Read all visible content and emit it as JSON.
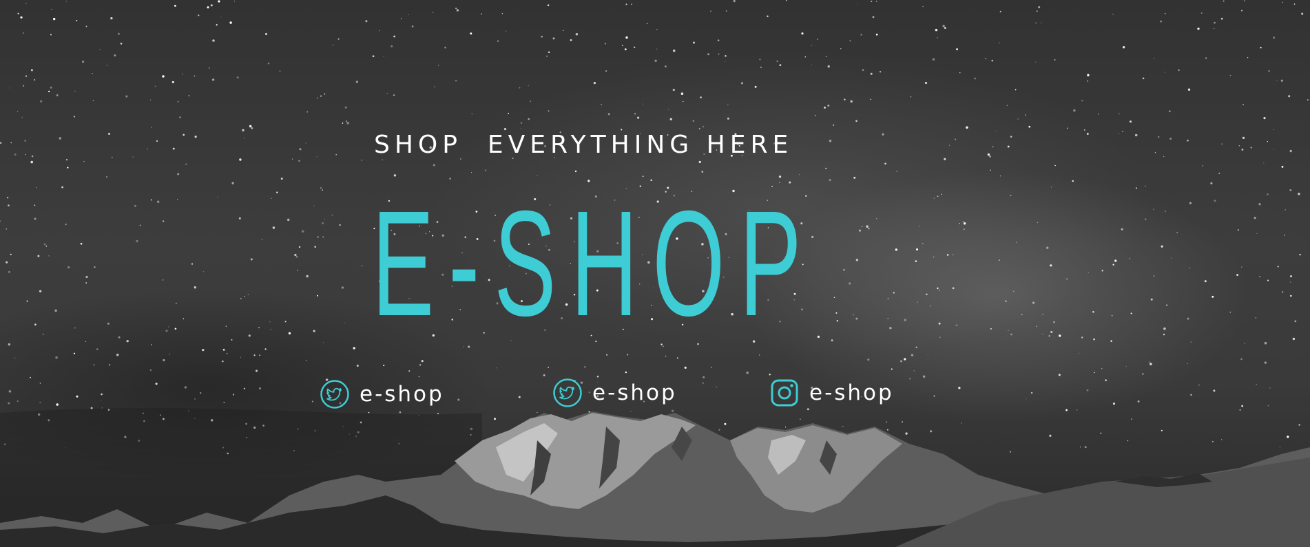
{
  "banner": {
    "tagline": "SHOP  EVERYTHING HERE",
    "brand": "E-SHOP",
    "accent_color": "#3ecdd4",
    "socials": [
      {
        "icon": "twitter-icon",
        "label": "e-shop"
      },
      {
        "icon": "twitter-icon",
        "label": "e-shop"
      },
      {
        "icon": "instagram-icon",
        "label": "e-shop"
      }
    ]
  }
}
